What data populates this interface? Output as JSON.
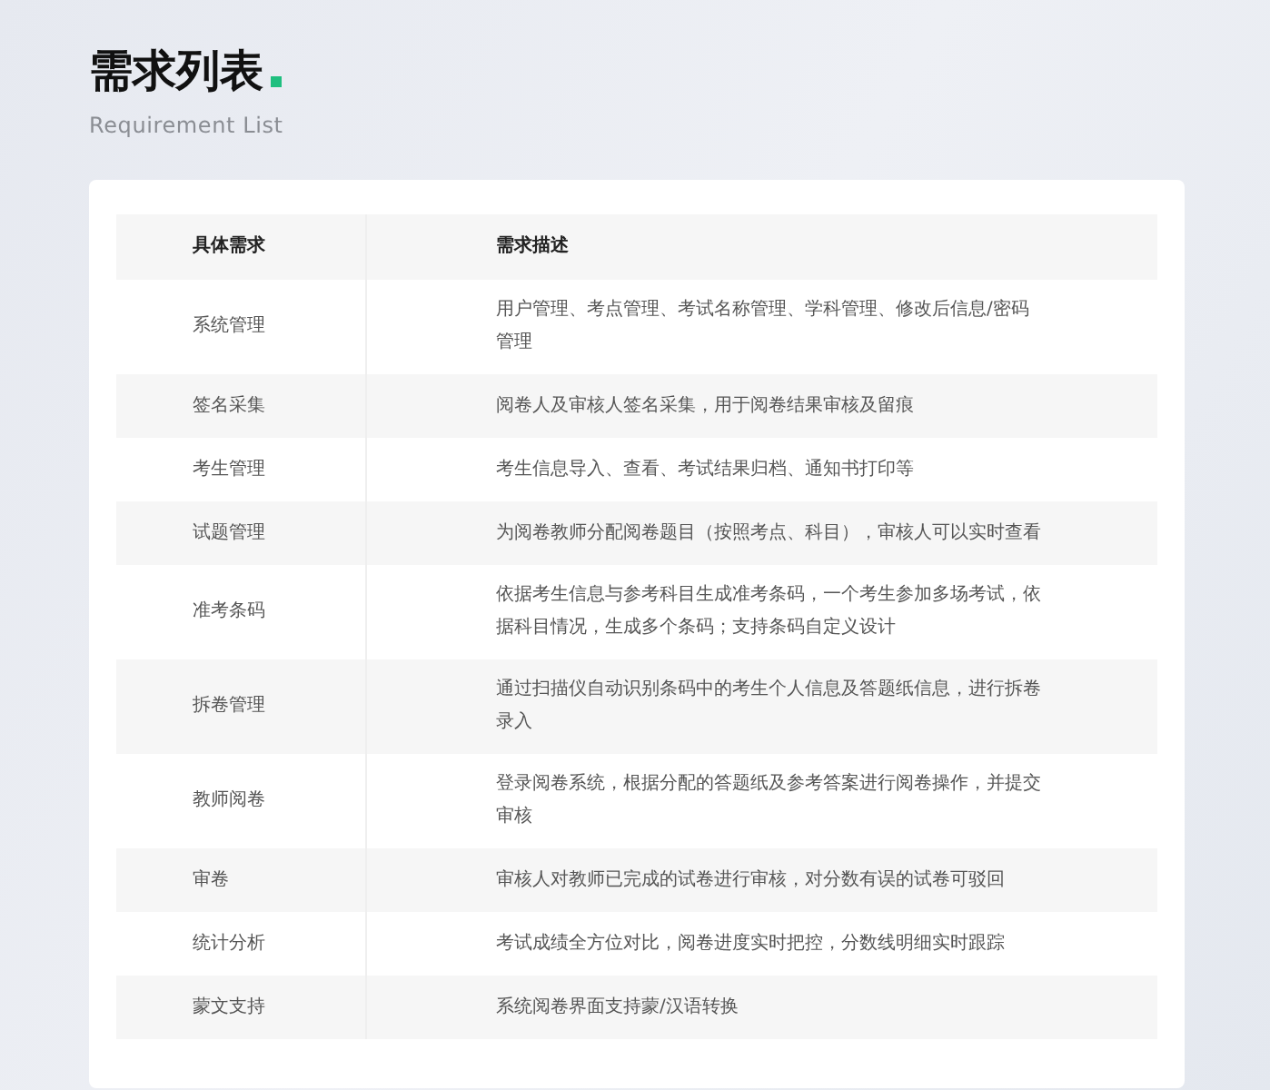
{
  "header": {
    "title": "需求列表",
    "subtitle": "Requirement List"
  },
  "table": {
    "columns": [
      "具体需求",
      "需求描述"
    ],
    "rows": [
      {
        "name": "系统管理",
        "description": "用户管理、考点管理、考试名称管理、学科管理、修改后信息/密码管理"
      },
      {
        "name": "签名采集",
        "description": "阅卷人及审核人签名采集，用于阅卷结果审核及留痕"
      },
      {
        "name": "考生管理",
        "description": "考生信息导入、查看、考试结果归档、通知书打印等"
      },
      {
        "name": "试题管理",
        "description": "为阅卷教师分配阅卷题目（按照考点、科目），审核人可以实时查看"
      },
      {
        "name": "准考条码",
        "description": "依据考生信息与参考科目生成准考条码，一个考生参加多场考试，依据科目情况，生成多个条码；支持条码自定义设计"
      },
      {
        "name": "拆卷管理",
        "description": "通过扫描仪自动识别条码中的考生个人信息及答题纸信息，进行拆卷录入"
      },
      {
        "name": "教师阅卷",
        "description": "登录阅卷系统，根据分配的答题纸及参考答案进行阅卷操作，并提交审核"
      },
      {
        "name": "审卷",
        "description": "审核人对教师已完成的试卷进行审核，对分数有误的试卷可驳回"
      },
      {
        "name": "统计分析",
        "description": "考试成绩全方位对比，阅卷进度实时把控，分数线明细实时跟踪"
      },
      {
        "name": "蒙文支持",
        "description": "系统阅卷界面支持蒙/汉语转换"
      }
    ]
  }
}
